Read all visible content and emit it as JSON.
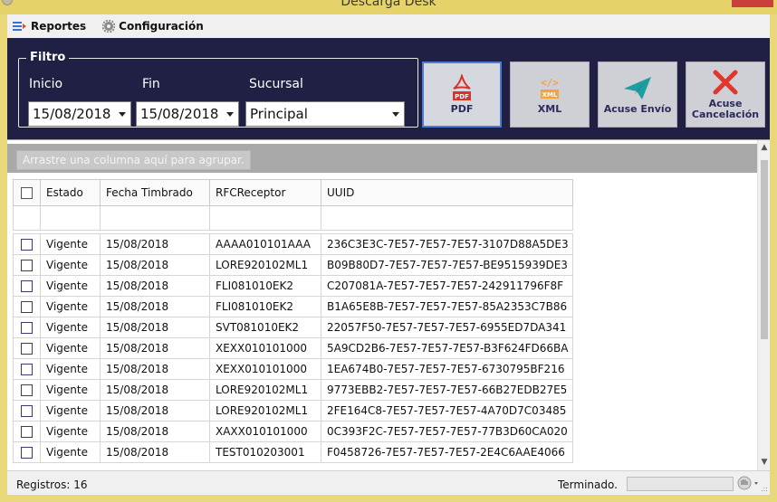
{
  "window": {
    "title": "Descarga Desk"
  },
  "menu": {
    "reportes": "Reportes",
    "configuracion": "Configuración"
  },
  "filtro": {
    "legend": "Filtro",
    "inicio_label": "Inicio",
    "fin_label": "Fin",
    "sucursal_label": "Sucursal",
    "inicio_value": "15/08/2018",
    "fin_value": "15/08/2018",
    "sucursal_value": "Principal"
  },
  "buttons": {
    "pdf": "PDF",
    "xml": "XML",
    "acuse_envio": "Acuse Envío",
    "acuse_cancelacion_1": "Acuse",
    "acuse_cancelacion_2": "Cancelación"
  },
  "icon_labels": {
    "pdf": "PDF",
    "xml": "XML"
  },
  "grid": {
    "group_hint": "Arrastre una columna aquí para agrupar.",
    "columns": [
      "Estado",
      "Fecha Timbrado",
      "RFCReceptor",
      "UUID"
    ],
    "rows": [
      {
        "estado": "Vigente",
        "fecha": "15/08/2018",
        "rfc": "AAAA010101AAA",
        "uuid": "236C3E3C-7E57-7E57-7E57-3107D88A5DE3"
      },
      {
        "estado": "Vigente",
        "fecha": "15/08/2018",
        "rfc": "LORE920102ML1",
        "uuid": "B09B80D7-7E57-7E57-7E57-BE9515939DE3"
      },
      {
        "estado": "Vigente",
        "fecha": "15/08/2018",
        "rfc": "FLI081010EK2",
        "uuid": "C207081A-7E57-7E57-7E57-242911796F8F"
      },
      {
        "estado": "Vigente",
        "fecha": "15/08/2018",
        "rfc": "FLI081010EK2",
        "uuid": "B1A65E8B-7E57-7E57-7E57-85A2353C7B86"
      },
      {
        "estado": "Vigente",
        "fecha": "15/08/2018",
        "rfc": "SVT081010EK2",
        "uuid": "22057F50-7E57-7E57-7E57-6955ED7DA341"
      },
      {
        "estado": "Vigente",
        "fecha": "15/08/2018",
        "rfc": "XEXX010101000",
        "uuid": "5A9CD2B6-7E57-7E57-7E57-B3F624FD66BA"
      },
      {
        "estado": "Vigente",
        "fecha": "15/08/2018",
        "rfc": "XEXX010101000",
        "uuid": "1EA674B0-7E57-7E57-7E57-6730795BF216"
      },
      {
        "estado": "Vigente",
        "fecha": "15/08/2018",
        "rfc": "LORE920102ML1",
        "uuid": "9773EBB2-7E57-7E57-7E57-66B27EDB27E5"
      },
      {
        "estado": "Vigente",
        "fecha": "15/08/2018",
        "rfc": "LORE920102ML1",
        "uuid": "2FE164C8-7E57-7E57-7E57-4A70D7C03485"
      },
      {
        "estado": "Vigente",
        "fecha": "15/08/2018",
        "rfc": "XAXX010101000",
        "uuid": "0C393F2C-7E57-7E57-7E57-77B3D60CA020"
      },
      {
        "estado": "Vigente",
        "fecha": "15/08/2018",
        "rfc": "TEST010203001",
        "uuid": "F0458726-7E57-7E57-7E57-2E4C6AAE4066"
      }
    ]
  },
  "status": {
    "registros": "Registros: 16",
    "state": "Terminado."
  },
  "colors": {
    "toolbar_bg": "#1f2043",
    "window_frame": "#e8d87a",
    "pdf_red": "#d9322a",
    "xml_orange": "#f2a33a",
    "send_teal": "#1f9ea0",
    "cancel_red": "#e0362c"
  }
}
